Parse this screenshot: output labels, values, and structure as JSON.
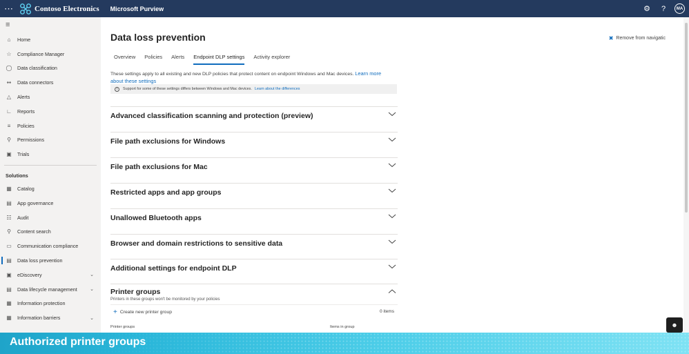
{
  "topbar": {
    "org_name": "Contoso Electronics",
    "app_name": "Microsoft Purview",
    "avatar_initials": "MA",
    "waffle_icon": "waffle-icon",
    "settings_icon": "gear-icon",
    "help_icon": "help-icon"
  },
  "nav": {
    "items": [
      {
        "label": "Home",
        "icon": "home-icon"
      },
      {
        "label": "Compliance Manager",
        "icon": "trophy-icon"
      },
      {
        "label": "Data classification",
        "icon": "classification-icon"
      },
      {
        "label": "Data connectors",
        "icon": "connector-icon"
      },
      {
        "label": "Alerts",
        "icon": "warning-icon"
      },
      {
        "label": "Reports",
        "icon": "chart-icon"
      },
      {
        "label": "Policies",
        "icon": "policies-icon"
      },
      {
        "label": "Permissions",
        "icon": "key-icon"
      },
      {
        "label": "Trials",
        "icon": "trials-icon"
      }
    ],
    "solutions_header": "Solutions",
    "solutions": [
      {
        "label": "Catalog",
        "icon": "catalog-icon"
      },
      {
        "label": "App governance",
        "icon": "app-icon"
      },
      {
        "label": "Audit",
        "icon": "audit-icon"
      },
      {
        "label": "Content search",
        "icon": "search-icon"
      },
      {
        "label": "Communication compliance",
        "icon": "chat-icon"
      },
      {
        "label": "Data loss prevention",
        "icon": "dlp-icon",
        "active": true
      },
      {
        "label": "eDiscovery",
        "icon": "ediscovery-icon",
        "expandable": true
      },
      {
        "label": "Data lifecycle management",
        "icon": "lifecycle-icon",
        "expandable": true
      },
      {
        "label": "Information protection",
        "icon": "protection-icon"
      },
      {
        "label": "Information barriers",
        "icon": "barrier-icon",
        "expandable": true
      }
    ]
  },
  "page": {
    "title": "Data loss prevention",
    "remove_nav": "Remove from navigatic",
    "tabs": [
      "Overview",
      "Policies",
      "Alerts",
      "Endpoint DLP settings",
      "Activity explorer"
    ],
    "active_tab": "Endpoint DLP settings",
    "description": "These settings apply to all existing and new DLP policies that protect content on endpoint Windows and Mac devices.",
    "description_link": "Learn more about these settings",
    "info": "Support for some of these settings differs between Windows and Mac devices.",
    "info_link": "Learn about the differences"
  },
  "sections": [
    {
      "title": "Advanced classification scanning and protection (preview)",
      "expanded": false
    },
    {
      "title": "File path exclusions for Windows",
      "expanded": false
    },
    {
      "title": "File path exclusions for Mac",
      "expanded": false
    },
    {
      "title": "Restricted apps and app groups",
      "expanded": false
    },
    {
      "title": "Unallowed Bluetooth apps",
      "expanded": false
    },
    {
      "title": "Browser and domain restrictions to sensitive data",
      "expanded": false
    },
    {
      "title": "Additional settings for endpoint DLP",
      "expanded": false
    },
    {
      "title": "Printer groups",
      "expanded": true
    }
  ],
  "printer_groups": {
    "subtitle": "Printers in these groups won't be monitored by your policies",
    "create_label": "Create new printer group",
    "items_count": "0 items",
    "col_printer_groups": "Printer groups",
    "col_items": "Items in group"
  },
  "banner": {
    "text": "Authorized printer groups"
  }
}
